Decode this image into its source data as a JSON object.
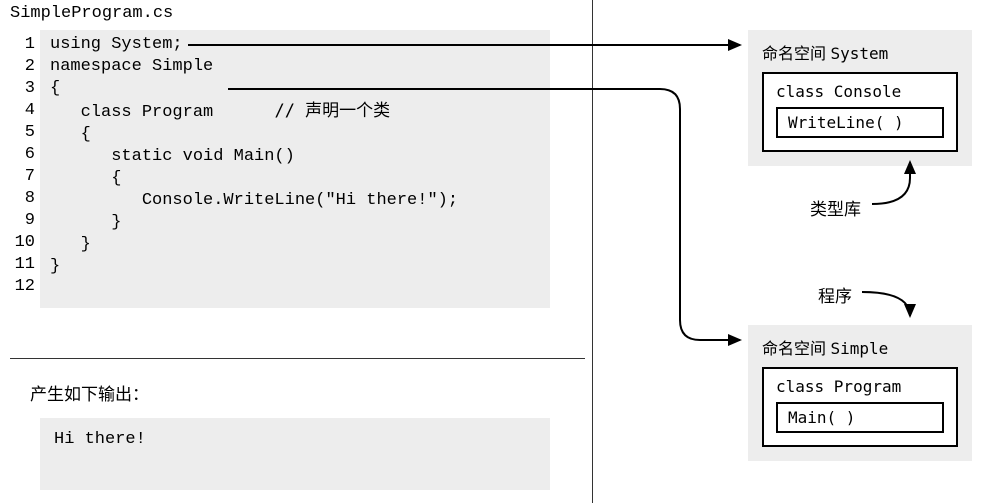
{
  "filename": "SimpleProgram.cs",
  "code": {
    "lines": [
      "using System;",
      "",
      "namespace Simple",
      "{",
      "   class Program",
      "   {",
      "      static void Main()",
      "      {",
      "         Console.WriteLine(\"Hi there!\");",
      "      }",
      "   }",
      "}"
    ],
    "comment_line5": "// 声明一个类"
  },
  "line_numbers": [
    "1",
    "2",
    "3",
    "4",
    "5",
    "6",
    "7",
    "8",
    "9",
    "10",
    "11",
    "12"
  ],
  "output_label": "产生如下输出：",
  "output_text": "Hi there!",
  "right": {
    "ns_system": {
      "title_prefix": "命名空间",
      "title_name": "System",
      "class_name": "class Console",
      "method": "WriteLine( )"
    },
    "type_lib_label": "类型库",
    "program_label": "程序",
    "ns_simple": {
      "title_prefix": "命名空间",
      "title_name": "Simple",
      "class_name": "class Program",
      "method": "Main( )"
    }
  }
}
